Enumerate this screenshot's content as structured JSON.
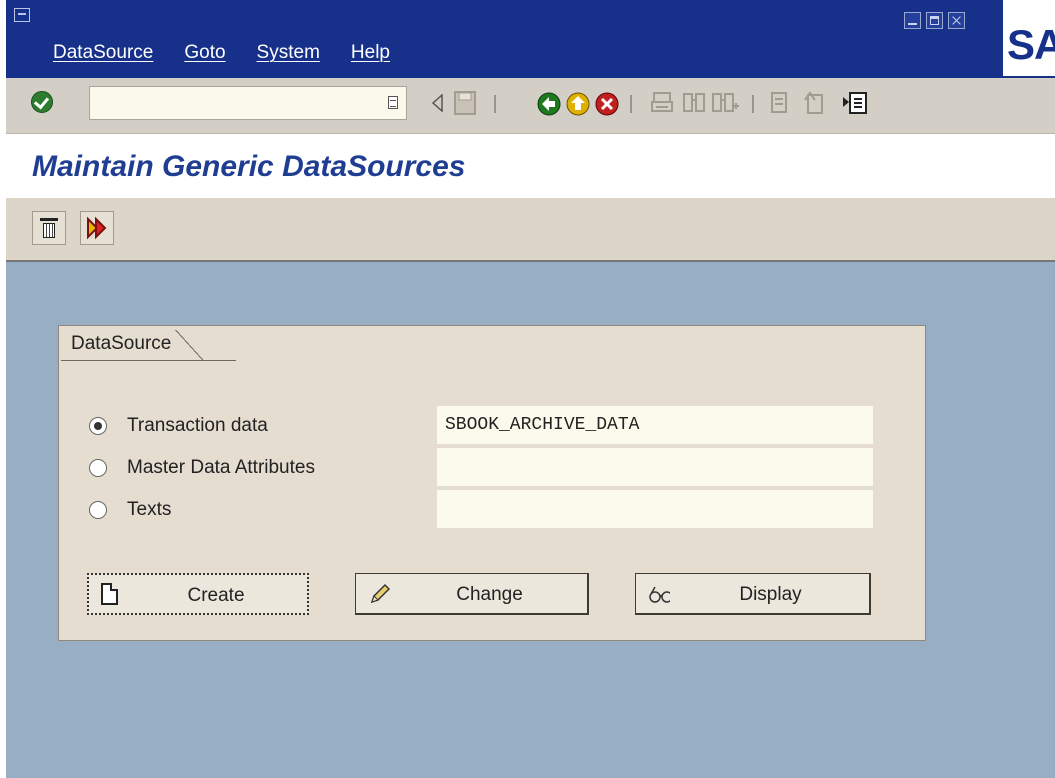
{
  "menu": {
    "items": [
      "DataSource",
      "Goto",
      "System",
      "Help"
    ]
  },
  "logo": {
    "text": "SAP"
  },
  "toolbar": {
    "command_value": "",
    "icons": {
      "enter": "enter-icon",
      "command_history": "command-history-icon",
      "back_arrow": "back-arrow-icon",
      "save": "save-icon",
      "back": "back-icon",
      "exit": "exit-icon",
      "cancel": "cancel-icon",
      "print": "print-icon",
      "find": "find-icon",
      "find_next": "find-next-icon",
      "first_page": "first-page-icon",
      "previous_page": "previous-page-icon",
      "create_session": "create-session-icon"
    }
  },
  "page": {
    "title": "Maintain Generic DataSources"
  },
  "app_toolbar": {
    "icons": [
      "delete-icon",
      "activate-icon"
    ]
  },
  "datasource": {
    "tab_label": "DataSource",
    "options": [
      {
        "label": "Transaction data",
        "value": "SBOOK_ARCHIVE_DATA",
        "selected": true
      },
      {
        "label": "Master Data Attributes",
        "value": "",
        "selected": false
      },
      {
        "label": "Texts",
        "value": "",
        "selected": false
      }
    ],
    "buttons": {
      "create": "Create",
      "change": "Change",
      "display": "Display"
    }
  },
  "colors": {
    "title_bar": "#17318a",
    "title_text": "#1f3d91",
    "work_area": "#97aec5",
    "group_box": "#e5ddd0",
    "input_bg": "#fbfaec"
  }
}
